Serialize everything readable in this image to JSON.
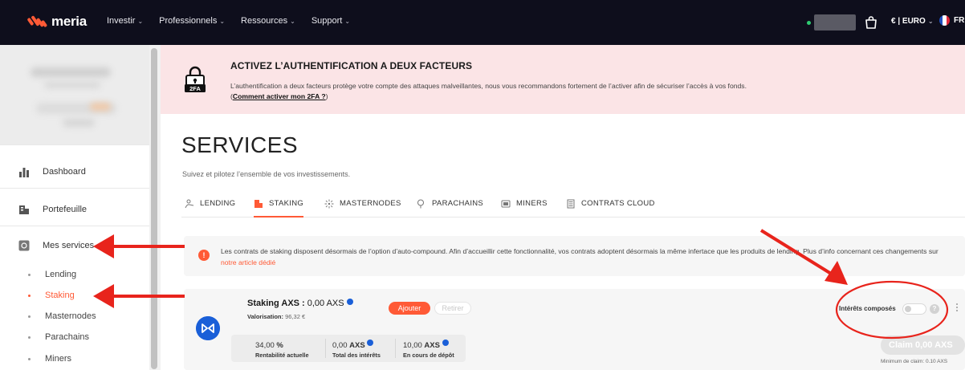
{
  "brand": {
    "name": "meria",
    "accent": "#ff5a36",
    "nav_bg": "#0e0e1c"
  },
  "nav": {
    "items": [
      {
        "label": "Investir"
      },
      {
        "label": "Professionnels"
      },
      {
        "label": "Ressources"
      },
      {
        "label": "Support"
      }
    ],
    "currency": "€ | EURO",
    "language": "FR"
  },
  "sidebar": {
    "items": [
      {
        "label": "Dashboard",
        "icon": "bar-chart-icon"
      },
      {
        "label": "Portefeuille",
        "icon": "wallet-icon"
      },
      {
        "label": "Mes services",
        "icon": "services-icon"
      }
    ],
    "sub_items": [
      {
        "label": "Lending",
        "active": false
      },
      {
        "label": "Staking",
        "active": true
      },
      {
        "label": "Masternodes",
        "active": false
      },
      {
        "label": "Parachains",
        "active": false
      },
      {
        "label": "Miners",
        "active": false
      }
    ]
  },
  "banner": {
    "icon": "lock-2fa-icon",
    "icon_text": "2FA",
    "title": "ACTIVEZ L’AUTHENTIFICATION A DEUX FACTEURS",
    "text": "L’authentification a deux facteurs protège votre compte des attaques malveillantes, nous vous recommandons fortement de l’activer afin de sécuriser l’accès à vos fonds.",
    "link_open": "(",
    "link": "Comment activer mon 2FA ?",
    "link_close": ")",
    "bg": "#fbe4e6"
  },
  "page": {
    "title": "SERVICES",
    "subtitle": "Suivez et pilotez l’ensemble de vos investissements."
  },
  "tabs": [
    {
      "label": "LENDING",
      "icon": "lending-icon",
      "active": false
    },
    {
      "label": "STAKING",
      "icon": "staking-icon",
      "active": true
    },
    {
      "label": "MASTERNODES",
      "icon": "masternodes-icon",
      "active": false
    },
    {
      "label": "PARACHAINS",
      "icon": "parachains-icon",
      "active": false
    },
    {
      "label": "MINERS",
      "icon": "miners-icon",
      "active": false
    },
    {
      "label": "CONTRATS CLOUD",
      "icon": "cloud-contracts-icon",
      "active": false
    }
  ],
  "info": {
    "icon": "alert-icon",
    "text": "Les contrats de staking disposent désormais de l’option d’auto-compound. Afin d’accueillir cette fonctionnalité, vos contrats adoptent désormais la même infertace que les produits de lending. Plus d’info concernant ces changements sur",
    "link": "notre article dédié"
  },
  "card": {
    "title_prefix": "Staking AXS : ",
    "amount": "0,00 AXS",
    "valuation_label": "Valorisation:",
    "valuation_value": "96,32 €",
    "add_label": "Ajouter",
    "remove_label": "Retirer",
    "token_icon": "axs-token-icon",
    "stats": [
      {
        "value": "34,00",
        "unit": "%",
        "label": "Rentabilité actuelle"
      },
      {
        "value": "0,00",
        "unit": "AXS",
        "label": "Total des intérêts"
      },
      {
        "value": "10,00",
        "unit": "AXS",
        "label": "En cours de dépôt"
      }
    ],
    "compound_label": "Intérêts composés",
    "compound_enabled": false,
    "help": "?",
    "claim_label": "Claim 0,00 AXS",
    "min_claim": "Minimum de claim: 0.10 AXS"
  },
  "annotation_color": "#e8241c"
}
